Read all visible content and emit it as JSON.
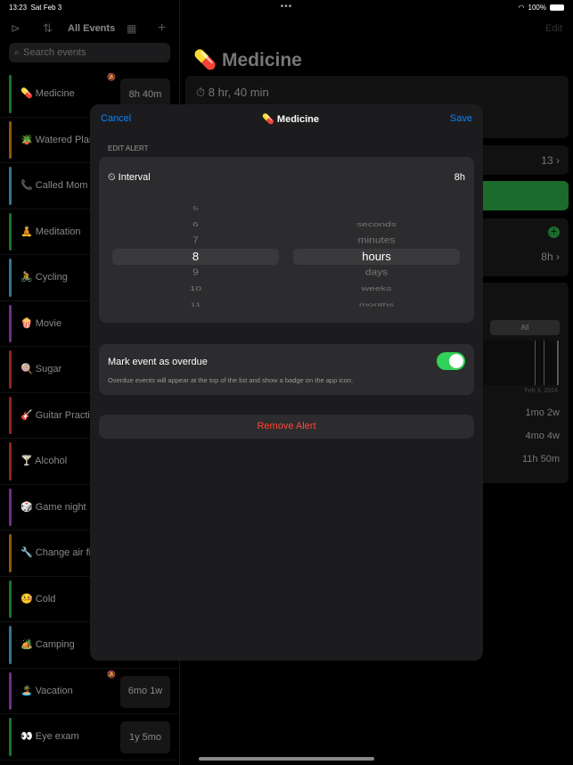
{
  "status": {
    "time": "13:23",
    "date": "Sat Feb 3",
    "battery": "100%"
  },
  "sidebar": {
    "title": "All Events",
    "search_placeholder": "Search events",
    "items": [
      {
        "label": "💊 Medicine",
        "color": "#30d158",
        "badge": "8h 40m",
        "muted": true
      },
      {
        "label": "🪴 Watered Plants",
        "color": "#ff9f0a"
      },
      {
        "label": "📞 Called Mom",
        "color": "#64d2ff"
      },
      {
        "label": "🧘 Meditation",
        "color": "#30d158"
      },
      {
        "label": "🚴 Cycling",
        "color": "#64d2ff"
      },
      {
        "label": "🍿 Movie",
        "color": "#bf5af2"
      },
      {
        "label": "🍭 Sugar",
        "color": "#ff453a"
      },
      {
        "label": "🎸 Guitar Practice",
        "color": "#ff453a"
      },
      {
        "label": "🍸 Alcohol",
        "color": "#ff453a"
      },
      {
        "label": "🎲 Game night",
        "color": "#bf5af2"
      },
      {
        "label": "🔧 Change air filter",
        "color": "#ff9f0a"
      },
      {
        "label": "🤒 Cold",
        "color": "#30d158"
      },
      {
        "label": "🏕️ Camping",
        "color": "#64d2ff"
      },
      {
        "label": "🏝️ Vacation",
        "color": "#bf5af2",
        "badge": "6mo 1w",
        "muted": true
      },
      {
        "label": "👀 Eye exam",
        "color": "#30d158",
        "badge": "1y 5mo"
      }
    ]
  },
  "main": {
    "edit": "Edit",
    "title": "💊 Medicine",
    "elapsed": "8 hr, 40 min",
    "count": "13",
    "alert": "8h",
    "filter": "All",
    "chart_date": "Feb 3, 2024",
    "stats": [
      "1mo 2w",
      "4mo 4w",
      "11h 50m"
    ]
  },
  "modal": {
    "cancel": "Cancel",
    "title": "💊 Medicine",
    "save": "Save",
    "section": "EDIT ALERT",
    "interval_label": "Interval",
    "interval_value": "8h",
    "numbers": [
      "5",
      "6",
      "7",
      "8",
      "9",
      "10",
      "11"
    ],
    "selected_number": "8",
    "units": [
      "seconds",
      "minutes",
      "hours",
      "days",
      "weeks",
      "months"
    ],
    "selected_unit": "hours",
    "overdue_label": "Mark event as overdue",
    "overdue_on": true,
    "overdue_note": "Overdue events will appear at the top of the list and show a badge on the app icon.",
    "remove": "Remove Alert"
  },
  "colors": {
    "accent": "#0a84ff",
    "toggle": "#30d158",
    "destructive": "#ff453a"
  }
}
